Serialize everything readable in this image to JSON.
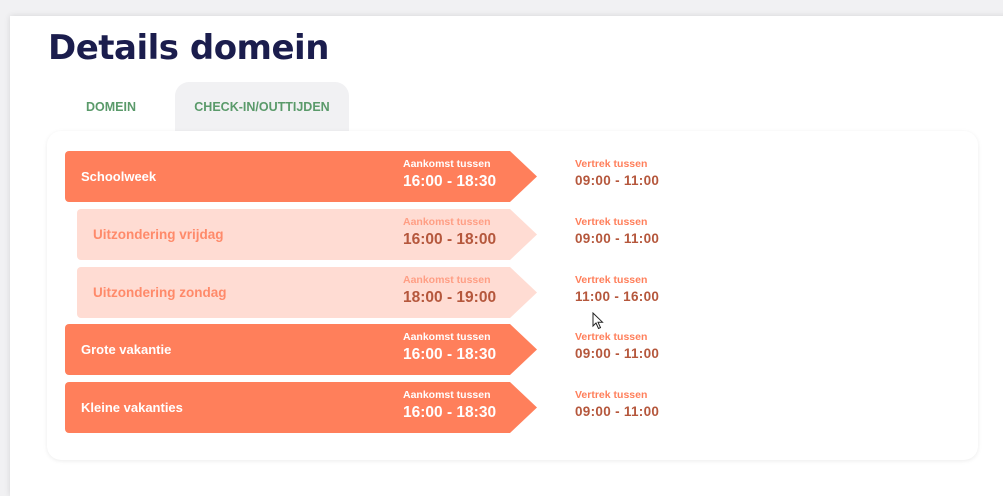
{
  "page": {
    "title": "Details domein"
  },
  "tabs": [
    {
      "label": "DOMEIN",
      "active": false
    },
    {
      "label": "CHECK-IN/OUTTIJDEN",
      "active": true
    }
  ],
  "colors": {
    "accent": "#ff7f5b",
    "accent_light": "#ffdcd3",
    "time_text": "#b5573c",
    "title": "#1b1d4d",
    "tab_text": "#5a9a6a"
  },
  "schedule": [
    {
      "name": "Schoolweek",
      "kind": "main",
      "arrival_label": "Aankomst tussen",
      "arrival": "16:00 - 18:30",
      "departure_label": "Vertrek tussen",
      "departure": "09:00 - 11:00"
    },
    {
      "name": "Uitzondering vrijdag",
      "kind": "exception",
      "arrival_label": "Aankomst tussen",
      "arrival": "16:00 - 18:00",
      "departure_label": "Vertrek tussen",
      "departure": "09:00 - 11:00"
    },
    {
      "name": "Uitzondering zondag",
      "kind": "exception",
      "arrival_label": "Aankomst tussen",
      "arrival": "18:00 - 19:00",
      "departure_label": "Vertrek tussen",
      "departure": "11:00 - 16:00"
    },
    {
      "name": "Grote vakantie",
      "kind": "main",
      "arrival_label": "Aankomst tussen",
      "arrival": "16:00 - 18:30",
      "departure_label": "Vertrek tussen",
      "departure": "09:00 - 11:00"
    },
    {
      "name": "Kleine vakanties",
      "kind": "main",
      "arrival_label": "Aankomst tussen",
      "arrival": "16:00 - 18:30",
      "departure_label": "Vertrek tussen",
      "departure": "09:00 - 11:00"
    }
  ],
  "cursor": {
    "icon": "mouse-pointer-icon"
  }
}
